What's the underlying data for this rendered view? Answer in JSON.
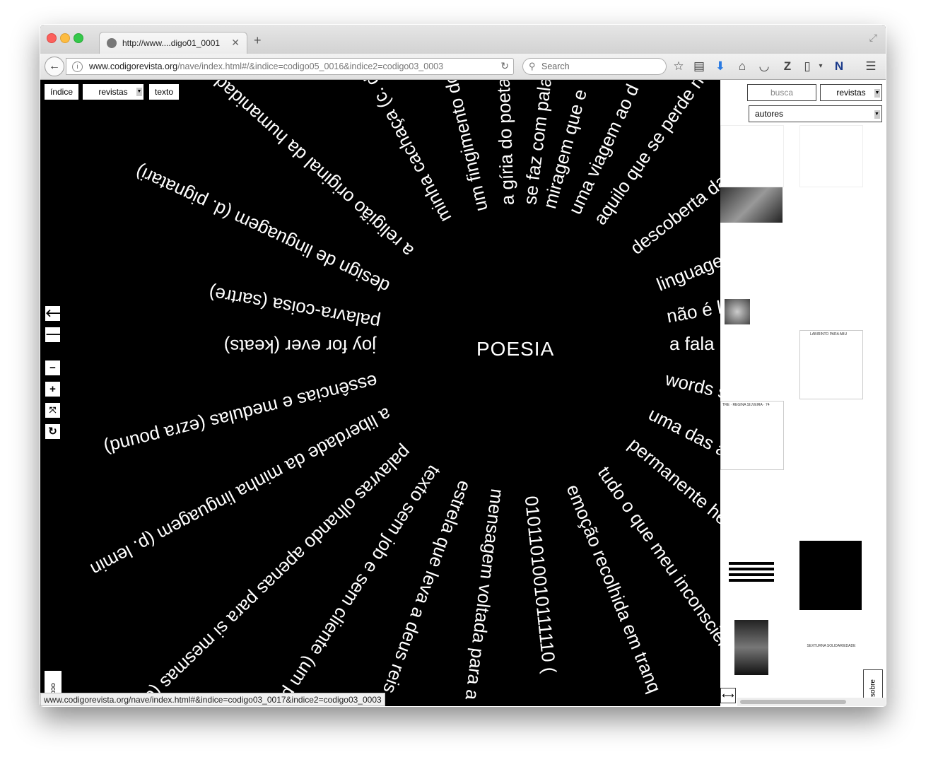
{
  "browser": {
    "tab_title": "http://www....digo01_0001",
    "url_domain": "www.codigorevista.org",
    "url_path": "/nave/index.html#/&indice=codigo05_0016&indice2=codigo03_0003",
    "search_placeholder": "Search",
    "status_url": "www.codigorevista.org/nave/index.html#&indice=codigo03_0017&indice2=codigo03_0003"
  },
  "topnav": {
    "indice": "índice",
    "revistas": "revistas",
    "texto": "texto"
  },
  "sidebar": {
    "busca": "busca",
    "revistas": "revistas",
    "autores": "autores",
    "sobre": "sobre",
    "thumb_caption_1": "LABIRINTO PARA ABU",
    "thumb_caption_2": "TRE · REGINA SILVEIRA · 74",
    "thumb_caption_3": "SEXTURNA SOLIDARIEDADE",
    "page_tab": "oco"
  },
  "graphic": {
    "center": "POESIA",
    "phrases": [
      "joy for ever (keats)",
      "palavra-coisa (sartre)",
      "design de linguagem (d. pignatari)",
      "a religião original da humanidade",
      "minha cachaça (c. drummond)",
      "um fingimento do",
      "a gíria do poeta",
      "se faz com pala",
      "miragem que e",
      "uma viagem ao d",
      "aquilo que se perde na",
      "descoberta das",
      "linguagem",
      "não é lite",
      "a fala do",
      "words se",
      "uma das art",
      "permanente  hesit",
      "tudo o que meu inconsciente",
      "emoção recolhida em tranq",
      "01011010010111110 (",
      "mensagem voltada para a",
      "estrela que leva a deus reis",
      "texto sem job e sem cliente (um p",
      "palavras olhando apenas para si mesmas (cecília",
      "a liberdade da minha linguagem (p. lemin",
      "essências e medulas (ezra pound)"
    ]
  }
}
